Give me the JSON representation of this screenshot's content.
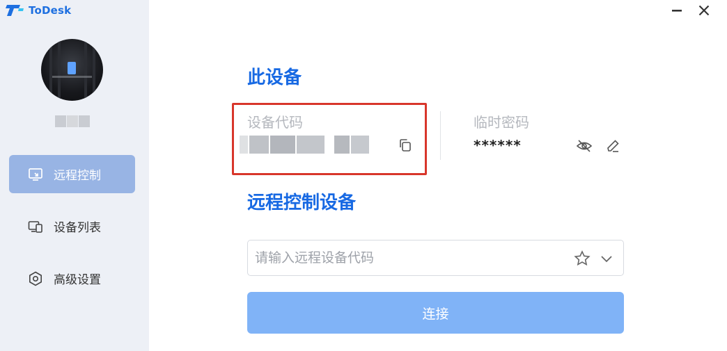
{
  "app": {
    "name": "ToDesk"
  },
  "colors": {
    "accent": "#1769e3",
    "sidebar_bg": "#edf0f6",
    "nav_active": "#98b4e4",
    "connect_button": "#80b3f7",
    "highlight_box": "#d8362b"
  },
  "sidebar": {
    "username": "",
    "items": [
      {
        "label": "远程控制",
        "icon": "remote-control-icon",
        "active": true
      },
      {
        "label": "设备列表",
        "icon": "device-list-icon",
        "active": false
      },
      {
        "label": "高级设置",
        "icon": "settings-icon",
        "active": false
      }
    ]
  },
  "window": {
    "minimize_icon": "minimize-icon",
    "close_icon": "close-icon"
  },
  "this_device": {
    "title": "此设备",
    "device_code_label": "设备代码",
    "device_code_value": "",
    "temp_password_label": "临时密码",
    "temp_password_value": "******"
  },
  "remote": {
    "title": "远程控制设备",
    "input_placeholder": "请输入远程设备代码",
    "input_value": "",
    "connect_label": "连接"
  }
}
